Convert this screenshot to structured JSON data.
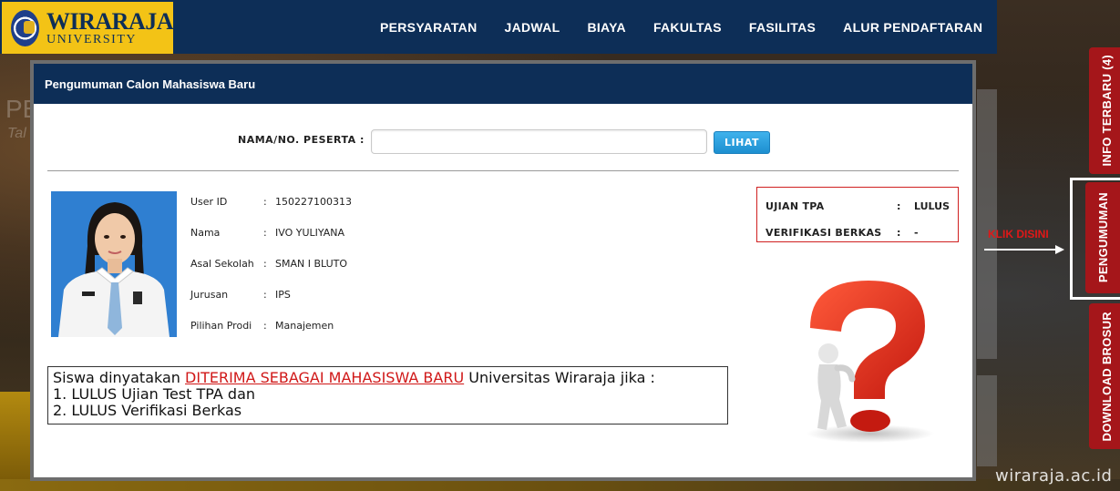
{
  "brand": {
    "name": "WIRARAJA",
    "sub": "UNIVERSITY",
    "color_primary": "#0d2e57",
    "color_logo_bg": "#f3c316"
  },
  "nav": {
    "items": [
      {
        "label": "PERSYARATAN"
      },
      {
        "label": "JADWAL"
      },
      {
        "label": "BIAYA"
      },
      {
        "label": "FAKULTAS"
      },
      {
        "label": "FASILITAS"
      },
      {
        "label": "ALUR PENDAFTARAN"
      }
    ]
  },
  "background": {
    "text1": "PE",
    "text2": "Tal"
  },
  "modal": {
    "title": "Pengumuman Calon Mahasiswa Baru",
    "search": {
      "label": "NAMA/NO. PESERTA  :",
      "value": "",
      "placeholder": "",
      "button": "LIHAT"
    },
    "student": {
      "fields": [
        {
          "key": "User ID",
          "sep": ":",
          "value": "150227100313"
        },
        {
          "key": "Nama",
          "sep": ":",
          "value": "IVO YULIYANA"
        },
        {
          "key": "Asal Sekolah",
          "sep": ":",
          "value": "SMAN I BLUTO"
        },
        {
          "key": "Jurusan",
          "sep": ":",
          "value": "IPS"
        },
        {
          "key": "Pilihan Prodi",
          "sep": ":",
          "value": "Manajemen"
        }
      ]
    },
    "status": {
      "rows": [
        {
          "key": "UJIAN TPA",
          "sep": ":",
          "value": "LULUS"
        },
        {
          "key": "VERIFIKASI BERKAS",
          "sep": ":",
          "value": "-"
        }
      ],
      "border_color": "#d02020"
    },
    "notice": {
      "prefix": "Siswa dinyatakan ",
      "highlight": "DITERIMA SEBAGAI MAHASISWA BARU",
      "suffix": " Universitas Wiraraja jika :",
      "line2": "1. LULUS Ujian Test TPA dan",
      "line3": "2. LULUS Verifikasi Berkas",
      "highlight_color": "#d01818"
    }
  },
  "side_tabs": {
    "info": "INFO TERBARU  (4)",
    "pengumuman": "PENGUMUMAN",
    "brosur": "DOWNLOAD BROSUR",
    "color": "#a5161a"
  },
  "callout": {
    "text": "KLIK DISINI"
  },
  "watermark": "wiraraja.ac.id"
}
